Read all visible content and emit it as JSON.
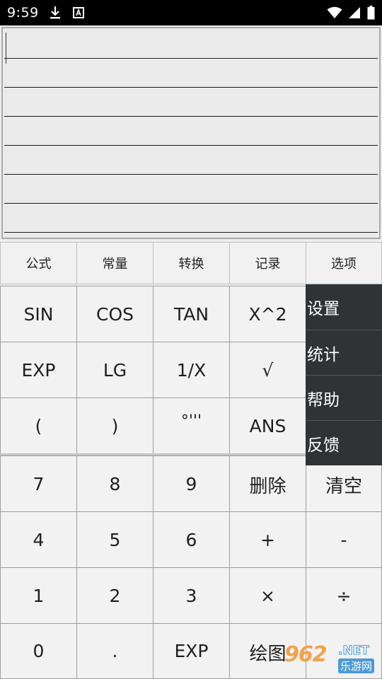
{
  "status_bar": {
    "time": "9:59",
    "icons": [
      "download-icon",
      "notification-a-icon",
      "wifi-icon",
      "signal-icon",
      "battery-icon"
    ]
  },
  "display": {
    "expression": ""
  },
  "tabs": [
    "公式",
    "常量",
    "转换",
    "记录",
    "选项"
  ],
  "function_keys": [
    [
      "SIN",
      "COS",
      "TAN",
      "X^2"
    ],
    [
      "EXP",
      "LG",
      "1/X",
      "√"
    ],
    [
      "(",
      ")",
      "°'''",
      "ANS"
    ]
  ],
  "keypad": [
    [
      "7",
      "8",
      "9",
      "删除",
      "清空"
    ],
    [
      "4",
      "5",
      "6",
      "+",
      "-"
    ],
    [
      "1",
      "2",
      "3",
      "×",
      "÷"
    ],
    [
      "0",
      ".",
      "EXP",
      "绘图",
      ""
    ]
  ],
  "options_menu": [
    "设置",
    "统计",
    "帮助",
    "反馈"
  ],
  "watermark": {
    "mark": "962",
    "domain": ".NET",
    "label": "乐游网"
  },
  "colors": {
    "status_bar": "#000000",
    "background": "#eeeeee",
    "key": "#f2f2f2",
    "menu": "#2f3336",
    "menu_text": "#ffffff"
  }
}
